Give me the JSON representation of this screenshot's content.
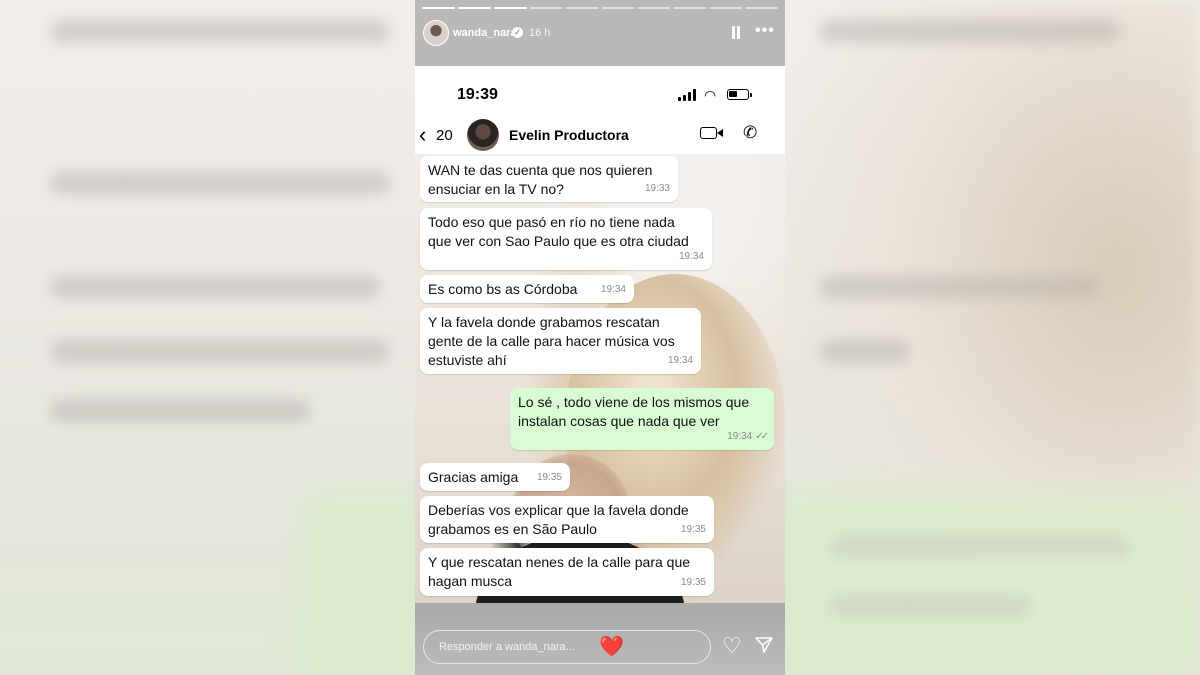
{
  "story": {
    "username": "wanda_nara",
    "time_ago": "16 h",
    "progress_segments": 10,
    "active_segment": 3,
    "reply_placeholder": "Responder a wanda_nara...",
    "quick_reaction": "❤️",
    "icons": [
      "pause-icon",
      "more-icon",
      "heart-icon",
      "send-icon",
      "verified-badge-icon"
    ]
  },
  "phone": {
    "clock": "19:39",
    "back_count": "20",
    "contact_name": "Evelin Productora"
  },
  "messages": [
    {
      "dir": "in",
      "text": "WAN te das cuenta que nos quieren\nensuciar en la TV no?",
      "time": "19:33"
    },
    {
      "dir": "in",
      "text": "Todo eso que pasó en río no tiene nada\nque ver con Sao Paulo que es otra ciudad",
      "time": "19:34"
    },
    {
      "dir": "in",
      "text": "Es como bs as Córdoba",
      "time": "19:34"
    },
    {
      "dir": "in",
      "text": "Y la favela donde grabamos rescatan\ngente de la calle para hacer música vos\nestuviste ahí",
      "time": "19:34"
    },
    {
      "dir": "out",
      "text": "Lo sé , todo viene de los mismos que\ninstalan cosas que nada que ver",
      "time": "19:34"
    },
    {
      "dir": "in",
      "text": "Gracias amiga",
      "time": "19:35"
    },
    {
      "dir": "in",
      "text": "Deberías vos explicar que la favela donde\ngrabamos es en São Paulo",
      "time": "19:35"
    },
    {
      "dir": "in",
      "text": "Y que rescatan nenes de la calle para que\nhagan musca",
      "time": "19:35"
    }
  ],
  "colors": {
    "incoming_bubble": "#ffffff",
    "outgoing_bubble": "#d9fdd3",
    "story_chrome": "#b8b8b8"
  }
}
